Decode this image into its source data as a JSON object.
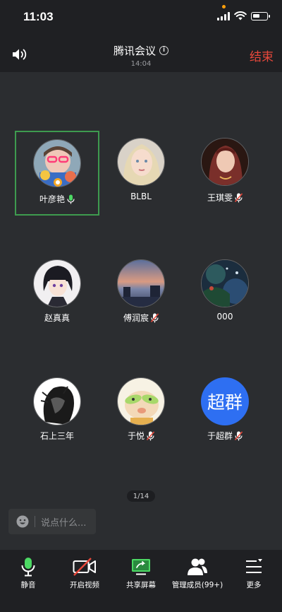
{
  "status_bar": {
    "time": "11:03",
    "battery_level": 0.45,
    "icons": [
      "signal-icon",
      "wifi-icon",
      "battery-icon"
    ]
  },
  "header": {
    "title": "腾讯会议",
    "duration": "14:04",
    "end_label": "结束",
    "end_color": "#e8483b",
    "icons": [
      "speaker-icon",
      "info-icon"
    ]
  },
  "participants": [
    {
      "name": "叶彦艳",
      "mic": "speaking",
      "active": true
    },
    {
      "name": "BLBL",
      "mic": "none",
      "active": false
    },
    {
      "name": "王琪雯",
      "mic": "muted",
      "active": false
    },
    {
      "name": "赵真真",
      "mic": "none",
      "active": false
    },
    {
      "name": "傅润宸",
      "mic": "muted",
      "active": false
    },
    {
      "name": "000",
      "mic": "none",
      "active": false
    },
    {
      "name": "石上三年",
      "mic": "none",
      "active": false
    },
    {
      "name": "于悦",
      "mic": "muted",
      "active": false
    },
    {
      "name": "于超群",
      "mic": "muted",
      "active": false,
      "avatar_text": "超群",
      "avatar_color": "#2e6ff2"
    }
  ],
  "page_indicator": "1/14",
  "chat": {
    "placeholder": "说点什么..."
  },
  "toolbar": {
    "items": [
      {
        "label": "静音",
        "icon": "microphone-icon"
      },
      {
        "label": "开启视频",
        "icon": "camera-off-icon"
      },
      {
        "label": "共享屏幕",
        "icon": "share-screen-icon"
      },
      {
        "label": "管理成员(99+)",
        "icon": "members-icon"
      },
      {
        "label": "更多",
        "icon": "more-menu-icon"
      }
    ]
  },
  "colors": {
    "background": "#2b2d30",
    "bars": "#1f2023",
    "active_border": "#3e9b4f",
    "mic_active": "#4cd964",
    "mic_muted": "#e8483b"
  }
}
